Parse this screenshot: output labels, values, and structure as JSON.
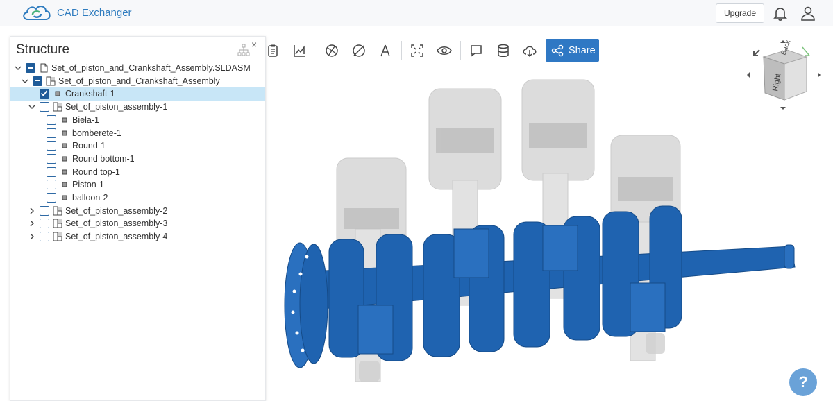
{
  "app": {
    "brand": "CAD Exchanger"
  },
  "header": {
    "upgrade_label": "Upgrade",
    "icons": [
      "bell-icon",
      "user-icon"
    ]
  },
  "toolbar": {
    "share_label": "Share",
    "icons": [
      "clipboard-icon",
      "chart-icon",
      "explode-icon",
      "section-icon",
      "measure-icon",
      "fit-icon",
      "visibility-icon",
      "comment-icon",
      "database-icon",
      "download-icon",
      "share-icon"
    ]
  },
  "structure": {
    "title": "Structure",
    "close_glyph": "×",
    "rows": [
      {
        "label": "Set_of_piston_and_Crankshaft_Assembly.SLDASM",
        "state": "partial",
        "expand": "down",
        "kind": "file"
      },
      {
        "label": "Set_of_piston_and_Crankshaft_Assembly",
        "state": "partial",
        "expand": "down",
        "kind": "assembly"
      },
      {
        "label": "Crankshaft-1",
        "state": "checked",
        "expand": "none",
        "kind": "part",
        "selected": true
      },
      {
        "label": "Set_of_piston_assembly-1",
        "state": "unchecked",
        "expand": "down",
        "kind": "assembly"
      },
      {
        "label": "Biela-1",
        "state": "unchecked",
        "expand": "none",
        "kind": "part"
      },
      {
        "label": "bomberete-1",
        "state": "unchecked",
        "expand": "none",
        "kind": "part"
      },
      {
        "label": "Round-1",
        "state": "unchecked",
        "expand": "none",
        "kind": "part"
      },
      {
        "label": "Round bottom-1",
        "state": "unchecked",
        "expand": "none",
        "kind": "part"
      },
      {
        "label": "Round top-1",
        "state": "unchecked",
        "expand": "none",
        "kind": "part"
      },
      {
        "label": "Piston-1",
        "state": "unchecked",
        "expand": "none",
        "kind": "part"
      },
      {
        "label": "balloon-2",
        "state": "unchecked",
        "expand": "none",
        "kind": "part"
      },
      {
        "label": "Set_of_piston_assembly-2",
        "state": "unchecked",
        "expand": "right",
        "kind": "assembly"
      },
      {
        "label": "Set_of_piston_assembly-3",
        "state": "unchecked",
        "expand": "right",
        "kind": "assembly"
      },
      {
        "label": "Set_of_piston_assembly-4",
        "state": "unchecked",
        "expand": "right",
        "kind": "assembly"
      }
    ]
  },
  "view_cube": {
    "front_label": "Right",
    "top_label": "Back"
  },
  "help": {
    "label": "?"
  },
  "colors": {
    "accent": "#2f78c4",
    "model": "#1f63b0",
    "selected_row": "#c8e6f7"
  }
}
